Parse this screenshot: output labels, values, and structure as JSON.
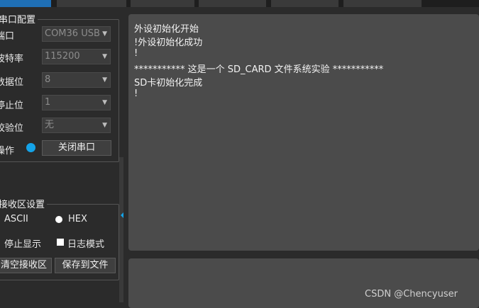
{
  "serial_group": {
    "title": "串口配置",
    "port": {
      "label": "端口",
      "value": "COM36 USB"
    },
    "baud": {
      "label": "波特率",
      "value": "115200"
    },
    "databits": {
      "label": "数据位",
      "value": "8"
    },
    "stopbits": {
      "label": "停止位",
      "value": "1"
    },
    "parity": {
      "label": "校验位",
      "value": "无"
    },
    "operation": {
      "label": "操作",
      "close_button": "关闭串口"
    }
  },
  "receive_group": {
    "title": "接收区设置",
    "ascii_label": "ASCII",
    "hex_label": "HEX",
    "stop_display_label": "停止显示",
    "log_mode_label": "日志模式",
    "clear_button": "清空接收区",
    "save_button": "保存到文件"
  },
  "receive_area": {
    "lines": [
      "外设初始化开始",
      "!外设初始化成功",
      "!",
      "*********** 这是一个 SD_CARD 文件系统实验 ***********",
      "SD卡初始化完成",
      "!"
    ]
  },
  "watermark": "CSDN @Chencyuser",
  "colors": {
    "led": "#14a3e8",
    "panel": "#4b4b4b",
    "background": "#2b2b2b"
  },
  "icons": {
    "dropdown": "chevron-down-icon",
    "status": "status-led"
  }
}
